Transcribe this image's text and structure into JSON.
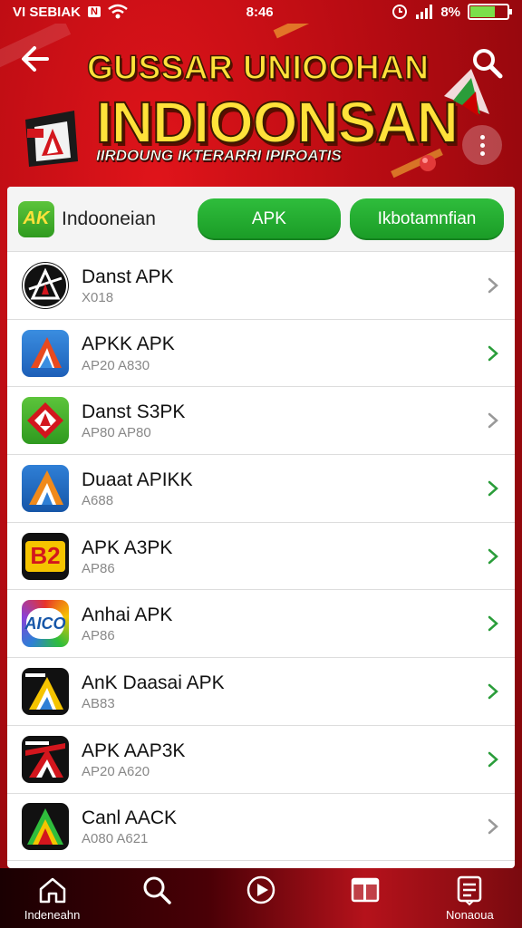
{
  "status_bar": {
    "carrier": "VI SEBIAK",
    "badge": "N",
    "time": "8:46",
    "battery_text": "8%",
    "battery_level": 0.7
  },
  "header": {
    "title_line1": "GUSSAR UNIOOHAN",
    "title_line2": "INDIOONSAN",
    "subtitle": "IIRDOUNG IKTERARRI IPIROATIS"
  },
  "filter": {
    "brand_logo": "AK",
    "brand_name": "Indooneian",
    "apk_button": "APK",
    "category_button": "Ikbotamnfian"
  },
  "apps": [
    {
      "name": "Danst APK",
      "sub": "X018",
      "chevron_color": "#999999"
    },
    {
      "name": "APKK APK",
      "sub": "AP20 A830",
      "chevron_color": "#2a9d3a"
    },
    {
      "name": "Danst S3PK",
      "sub": "AP80 AP80",
      "chevron_color": "#999999"
    },
    {
      "name": "Duaat APIKK",
      "sub": "A688",
      "chevron_color": "#2a9d3a"
    },
    {
      "name": "APK A3PK",
      "sub": "AP86",
      "chevron_color": "#2a9d3a"
    },
    {
      "name": "Anhai APK",
      "sub": "AP86",
      "chevron_color": "#2a9d3a"
    },
    {
      "name": "AnK Daasai APK",
      "sub": "AB83",
      "chevron_color": "#2a9d3a"
    },
    {
      "name": "APK AAP3K",
      "sub": "AP20 A620",
      "chevron_color": "#2a9d3a"
    },
    {
      "name": "Canl AACK",
      "sub": "A080 A621",
      "chevron_color": "#999999"
    }
  ],
  "app_icon_labels": {
    "icon5": "B2",
    "icon6": "AICO"
  },
  "bottom_nav": [
    {
      "label": "Indeneahn",
      "icon": "home-icon"
    },
    {
      "label": "",
      "icon": "search-icon"
    },
    {
      "label": "",
      "icon": "play-circle-icon"
    },
    {
      "label": "",
      "icon": "window-icon"
    },
    {
      "label": "Nonaoua",
      "icon": "list-icon"
    }
  ],
  "colors": {
    "accent_green": "#1fa52c",
    "header_red": "#c8101a",
    "title_yellow": "#ffe23a"
  }
}
